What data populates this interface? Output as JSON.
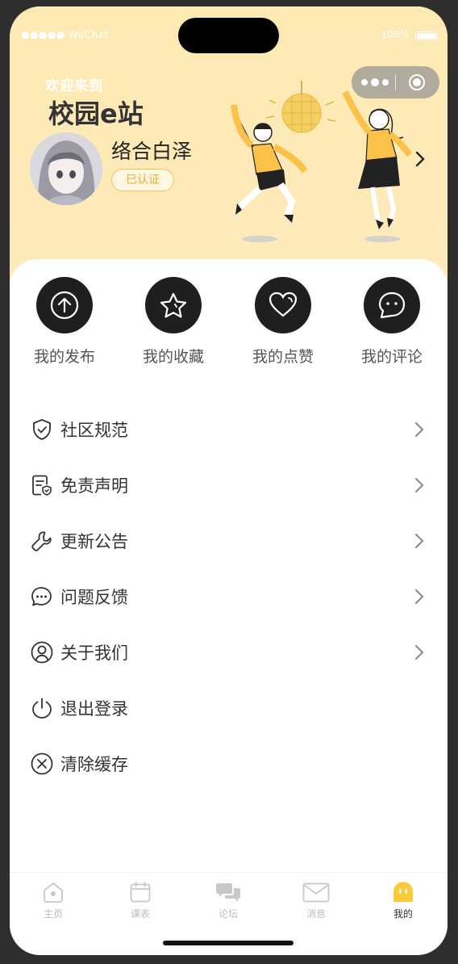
{
  "status_bar": {
    "carrier": "●●●●● WeChat",
    "battery": "100%"
  },
  "header": {
    "welcome": "欢迎来到",
    "app_title": "校园e站",
    "username": "络合白泽",
    "badge": "已认证",
    "background_color": "#feeab8"
  },
  "quick_actions": [
    {
      "label": "我的发布",
      "icon": "upload-arrow-icon"
    },
    {
      "label": "我的收藏",
      "icon": "star-icon"
    },
    {
      "label": "我的点赞",
      "icon": "heart-icon"
    },
    {
      "label": "我的评论",
      "icon": "chat-bubble-icon"
    }
  ],
  "menu": [
    {
      "label": "社区规范",
      "icon": "shield-check-icon",
      "chevron": true
    },
    {
      "label": "免责声明",
      "icon": "document-shield-icon",
      "chevron": true
    },
    {
      "label": "更新公告",
      "icon": "wrench-icon",
      "chevron": true
    },
    {
      "label": "问题反馈",
      "icon": "feedback-bubble-icon",
      "chevron": true
    },
    {
      "label": "关于我们",
      "icon": "user-circle-icon",
      "chevron": true
    },
    {
      "label": "退出登录",
      "icon": "power-icon",
      "chevron": false
    },
    {
      "label": "清除缓存",
      "icon": "close-circle-icon",
      "chevron": false
    }
  ],
  "tabbar": [
    {
      "label": "主页",
      "icon": "home-icon",
      "active": false
    },
    {
      "label": "课表",
      "icon": "calendar-icon",
      "active": false
    },
    {
      "label": "论坛",
      "icon": "forum-icon",
      "active": false
    },
    {
      "label": "消息",
      "icon": "mail-icon",
      "active": false
    },
    {
      "label": "我的",
      "icon": "profile-ghost-icon",
      "active": true
    }
  ],
  "colors": {
    "accent": "#fbc93a",
    "dark_icon_bg": "#1f1f1f",
    "badge_text": "#f0a832"
  }
}
